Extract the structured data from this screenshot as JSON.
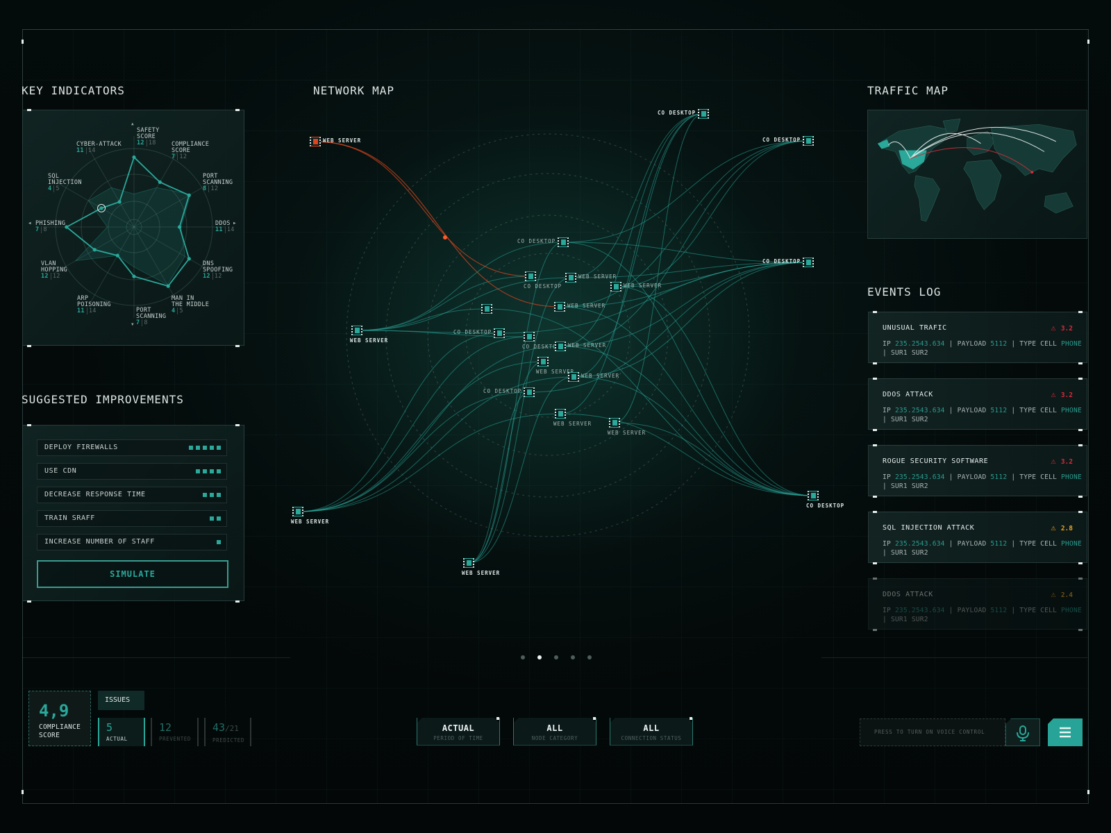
{
  "titles": {
    "key_indicators": "KEY INDICATORS",
    "network_map": "NETWORK MAP",
    "traffic_map": "TRAFFIC MAP",
    "suggested": "SUGGESTED IMPROVEMENTS",
    "events_log": "EVENTS LOG"
  },
  "radar": {
    "axes": [
      {
        "label": "SAFETY\nSCORE",
        "value": "12",
        "max": "18",
        "level": 0.89,
        "area": 0.42
      },
      {
        "label": "COMPLIANCE\nSCORE",
        "value": "7",
        "max": "12",
        "level": 0.66,
        "area": 0.58
      },
      {
        "label": "PORT\nSCANNING",
        "value": "8",
        "max": "12",
        "level": 0.81,
        "area": 0.83
      },
      {
        "label": "DDOS",
        "value": "11",
        "max": "14",
        "level": 0.58,
        "area": 0.6
      },
      {
        "label": "DNS\nSPOOFING",
        "value": "12",
        "max": "12",
        "level": 0.81,
        "area": 0.75
      },
      {
        "label": "MAN IN\nTHE MIDDLE",
        "value": "4",
        "max": "5",
        "level": 0.87,
        "area": 0.85
      },
      {
        "label": "PORT\nSCANNING",
        "value": "7",
        "max": "8",
        "level": 0.63,
        "area": 0.51
      },
      {
        "label": "ARP\nPOISONING",
        "value": "11",
        "max": "14",
        "level": 0.42,
        "area": 0.42
      },
      {
        "label": "VLAN\nHOPPING",
        "value": "12",
        "max": "12",
        "level": 0.58,
        "area": 0.86
      },
      {
        "label": "PHISHING",
        "value": "7",
        "max": "8",
        "level": 0.86,
        "area": 0.34
      },
      {
        "label": "SQL\nINJECTION",
        "value": "4",
        "max": "5",
        "level": 0.48,
        "area": 0.67
      },
      {
        "label": "CYBER-ATTACK",
        "value": "11",
        "max": "14",
        "level": 0.37,
        "area": 0.58
      }
    ],
    "selected_axis": 10
  },
  "improvements": [
    {
      "label": "DEPLOY FIREWALLS",
      "level": 5
    },
    {
      "label": "USE CDN",
      "level": 4
    },
    {
      "label": "DECREASE RESPONSE TIME",
      "level": 3
    },
    {
      "label": "TRAIN SRAFF",
      "level": 2
    },
    {
      "label": "INCREASE NUMBER OF STAFF",
      "level": 1
    }
  ],
  "simulate_label": "SIMULATE",
  "network": {
    "nodes": [
      {
        "label": "WEB SERVER",
        "status": "alert"
      },
      {
        "label": "CO DESKTOP"
      },
      {
        "label": "CO DESKTOP"
      },
      {
        "label": "CO DESKTOP"
      },
      {
        "label": "CO DESKTOP"
      },
      {
        "label": "WEB SERVER"
      },
      {
        "label": "WEB SERVER"
      },
      {
        "label": "WEB SERVER"
      },
      {
        "label": "CO DESKTOP"
      },
      {
        "label": "CO DESKTOP"
      },
      {
        "label": "WEB SERVER"
      },
      {
        "label": "WEB SERVER"
      },
      {
        "label": "WEB SERVER"
      },
      {
        "label": ""
      },
      {
        "label": "CO DESKTOP"
      },
      {
        "label": "CO DESKTOP"
      },
      {
        "label": "WEB SERVER"
      },
      {
        "label": "WEB SERVER"
      },
      {
        "label": "WEB SERVER"
      },
      {
        "label": "CO DESKTOP"
      },
      {
        "label": "WEB SERVER"
      },
      {
        "label": "WEB SERVER"
      }
    ],
    "links": [
      [
        1,
        10
      ],
      [
        1,
        16
      ],
      [
        1,
        18
      ],
      [
        1,
        21
      ],
      [
        1,
        20
      ],
      [
        2,
        11
      ],
      [
        2,
        12
      ],
      [
        2,
        16
      ],
      [
        2,
        8
      ],
      [
        3,
        8
      ],
      [
        3,
        10
      ],
      [
        3,
        11
      ],
      [
        3,
        12
      ],
      [
        3,
        16
      ],
      [
        3,
        18
      ],
      [
        3,
        19
      ],
      [
        3,
        14
      ],
      [
        4,
        8
      ],
      [
        4,
        11
      ],
      [
        4,
        12
      ],
      [
        4,
        16
      ],
      [
        4,
        18
      ],
      [
        4,
        20
      ],
      [
        4,
        21
      ],
      [
        4,
        13
      ],
      [
        5,
        9
      ],
      [
        5,
        13
      ],
      [
        5,
        14
      ],
      [
        5,
        10
      ],
      [
        5,
        8
      ],
      [
        5,
        15
      ],
      [
        6,
        14
      ],
      [
        6,
        15
      ],
      [
        6,
        17
      ],
      [
        6,
        19
      ],
      [
        6,
        20
      ],
      [
        6,
        18
      ],
      [
        6,
        16
      ],
      [
        7,
        17
      ],
      [
        7,
        19
      ],
      [
        7,
        18
      ],
      [
        7,
        10
      ],
      [
        7,
        8
      ]
    ],
    "alert_links": [
      [
        0,
        12
      ],
      [
        0,
        9
      ]
    ]
  },
  "events": [
    {
      "title": "UNUSUAL TRAFIC",
      "severity": "3.2",
      "color": "#e0283c",
      "ip_label": "IP",
      "ip": "235.2543.634",
      "payload_label": "| PAYLOAD",
      "payload": "5112",
      "type_label": "| TYPE CELL",
      "type": "PHONE",
      "tail": "| SUR1 SUR2"
    },
    {
      "title": "DDOS ATTACK",
      "severity": "3.2",
      "color": "#e0283c",
      "ip_label": "IP",
      "ip": "235.2543.634",
      "payload_label": "| PAYLOAD",
      "payload": "5112",
      "type_label": "| TYPE CELL",
      "type": "PHONE",
      "tail": "| SUR1 SUR2"
    },
    {
      "title": "ROGUE SECURITY SOFTWARE",
      "severity": "3.2",
      "color": "#e0283c",
      "ip_label": "IP",
      "ip": "235.2543.634",
      "payload_label": "| PAYLOAD",
      "payload": "5112",
      "type_label": "| TYPE CELL",
      "type": "PHONE",
      "tail": "| SUR1 SUR2"
    },
    {
      "title": "SQL INJECTION ATTACK",
      "severity": "2.8",
      "color": "#e8a020",
      "ip_label": "IP",
      "ip": "235.2543.634",
      "payload_label": "| PAYLOAD",
      "payload": "5112",
      "type_label": "| TYPE CELL",
      "type": "PHONE",
      "tail": "| SUR1 SUR2"
    },
    {
      "title": "DDOS ATTACK",
      "severity": "2.4",
      "color": "#e8a020",
      "ip_label": "IP",
      "ip": "235.2543.634",
      "payload_label": "| PAYLOAD",
      "payload": "5112",
      "type_label": "| TYPE CELL",
      "type": "PHONE",
      "tail": "| SUR1 SUR2"
    }
  ],
  "pagination": {
    "count": 5,
    "active": 1
  },
  "compliance": {
    "score": "4,9",
    "label": "COMPLIANCE\nSCORE"
  },
  "issues": {
    "tab": "ISSUES",
    "actual": "5",
    "actual_label": "ACTUAL",
    "prevented": "12",
    "prevented_label": "PREVENTED",
    "predicted": "43",
    "predicted_of": "/21",
    "predicted_label": "PREDICTED"
  },
  "filters": [
    {
      "value": "ACTUAL",
      "caption": "PERIOD OF TIME"
    },
    {
      "value": "ALL",
      "caption": "NODE CATEGORY"
    },
    {
      "value": "ALL",
      "caption": "CONNECTION STATUS"
    }
  ],
  "voice": {
    "placeholder": "PRESS TO TURN ON VOICE CONTROL"
  },
  "colors": {
    "accent": "#2aa89a",
    "alert": "#e0283c",
    "warning": "#e8a020",
    "background": "#040a0a"
  }
}
